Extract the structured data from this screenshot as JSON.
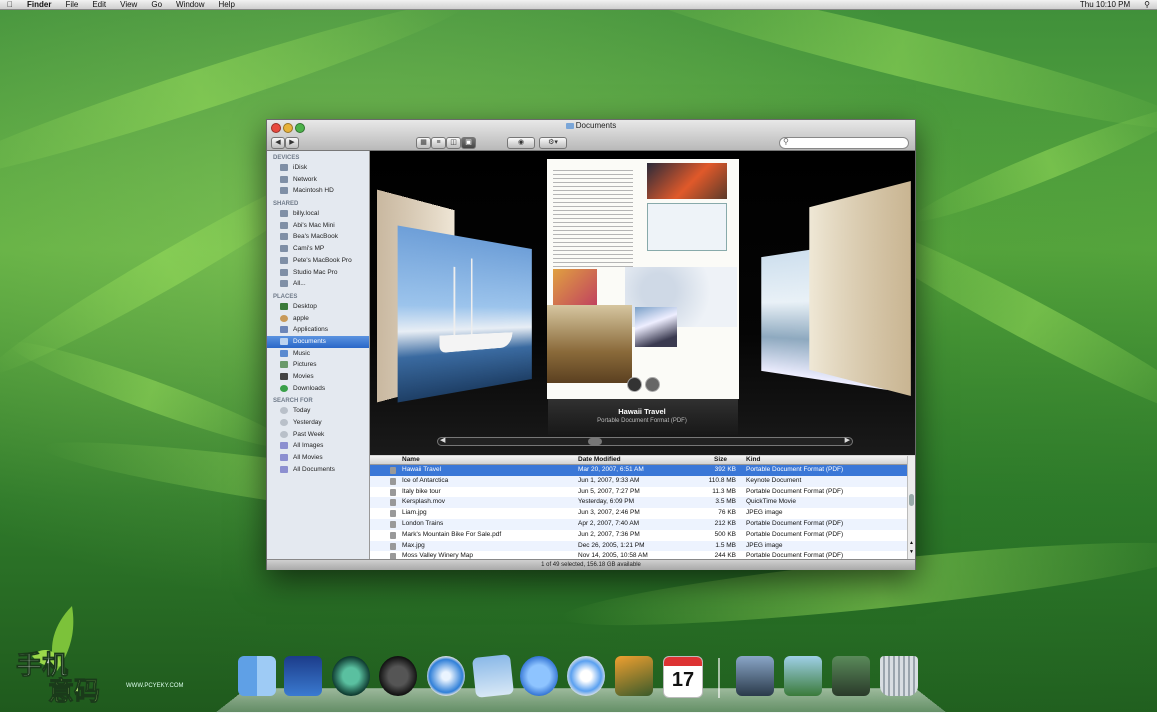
{
  "menubar": {
    "apple_icon": "apple-icon",
    "items": [
      "Finder",
      "File",
      "Edit",
      "View",
      "Go",
      "Window",
      "Help"
    ],
    "clock": "Thu 10:10 PM",
    "spotlight_icon": "magnifier-icon"
  },
  "window": {
    "title": "Documents",
    "status": "1 of 49 selected, 156.18 GB available"
  },
  "sidebar": {
    "devices_header": "DEVICES",
    "devices": [
      "iDisk",
      "Network",
      "Macintosh HD"
    ],
    "shared_header": "SHARED",
    "shared": [
      "billy.local",
      "Abi's Mac Mini",
      "Bea's MacBook",
      "Cami's MP",
      "Pete's MacBook Pro",
      "Studio Mac Pro",
      "All..."
    ],
    "places_header": "PLACES",
    "places": [
      "Desktop",
      "apple",
      "Applications",
      "Documents",
      "Music",
      "Pictures",
      "Movies",
      "Downloads"
    ],
    "search_header": "SEARCH FOR",
    "search": [
      "Today",
      "Yesterday",
      "Past Week",
      "All Images",
      "All Movies",
      "All Documents"
    ]
  },
  "coverflow": {
    "title": "Hawaii Travel",
    "subtitle": "Portable Document Format (PDF)"
  },
  "list": {
    "headers": [
      "Name",
      "Date Modified",
      "Size",
      "Kind"
    ],
    "rows": [
      {
        "name": "Hawaii Travel",
        "date": "Mar 20, 2007, 6:51 AM",
        "size": "392 KB",
        "kind": "Portable Document Format (PDF)"
      },
      {
        "name": "Ice of Antarctica",
        "date": "Jun 1, 2007, 9:33 AM",
        "size": "110.8 MB",
        "kind": "Keynote Document"
      },
      {
        "name": "Italy bike tour",
        "date": "Jun 5, 2007, 7:27 PM",
        "size": "11.3 MB",
        "kind": "Portable Document Format (PDF)"
      },
      {
        "name": "Kersplash.mov",
        "date": "Yesterday, 6:09 PM",
        "size": "3.5 MB",
        "kind": "QuickTime Movie"
      },
      {
        "name": "Liam.jpg",
        "date": "Jun 3, 2007, 2:46 PM",
        "size": "76 KB",
        "kind": "JPEG image"
      },
      {
        "name": "London Trains",
        "date": "Apr 2, 2007, 7:40 AM",
        "size": "212 KB",
        "kind": "Portable Document Format (PDF)"
      },
      {
        "name": "Mark's Mountain Bike For Sale.pdf",
        "date": "Jun 2, 2007, 7:36 PM",
        "size": "500 KB",
        "kind": "Portable Document Format (PDF)"
      },
      {
        "name": "Max.jpg",
        "date": "Dec 26, 2005, 1:21 PM",
        "size": "1.5 MB",
        "kind": "JPEG image"
      },
      {
        "name": "Moss Valley Winery Map",
        "date": "Nov 14, 2005, 10:58 AM",
        "size": "244 KB",
        "kind": "Portable Document Format (PDF)"
      }
    ]
  },
  "dock": {
    "icons": [
      "finder-icon",
      "spaces-icon",
      "time-machine-icon",
      "dashboard-icon",
      "safari-icon",
      "mail-icon",
      "ichat-icon",
      "itunes-icon",
      "iphoto-icon",
      "ical-icon",
      "stack-icon",
      "stack-icon",
      "stack-icon",
      "trash-icon"
    ],
    "ical_date": "17"
  },
  "watermark": {
    "url": "WWW.PCYEKY.COM"
  },
  "colors": {
    "selection": "#3a77d7",
    "accent_sidebar": "#2a67c8"
  }
}
